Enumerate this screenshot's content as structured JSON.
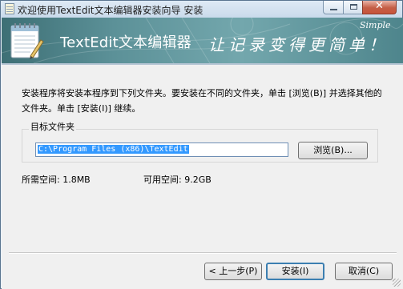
{
  "titlebar": {
    "title": "欢迎使用TextEdit文本编辑器安装向导 安装",
    "buttons": {
      "min": "—",
      "max": "☐",
      "close": "✕"
    }
  },
  "banner": {
    "app_name": "TextEdit文本编辑器",
    "slogan": "让记录变得更简单！",
    "simple_label": "Simple",
    "icon": "notepad-icon"
  },
  "body": {
    "instruction": "安装程序将安装本程序到下列文件夹。要安装在不同的文件夹，单击 [浏览(B)] 并选择其他的文件夹。单击 [安装(I)] 继续。",
    "group_label": "目标文件夹",
    "path_value": "C:\\Program Files (x86)\\TextEdit",
    "browse_label": "浏览(B)...",
    "space_required": "所需空间: 1.8MB",
    "space_available": "可用空间: 9.2GB"
  },
  "footer": {
    "back_label": "< 上一步(P)",
    "install_label": "安装(I)",
    "cancel_label": "取消(C)"
  },
  "colors": {
    "banner_dark": "#3d6f75",
    "banner_light": "#73a7ad",
    "selection": "#3399ff",
    "close_button": "#c8543b"
  }
}
